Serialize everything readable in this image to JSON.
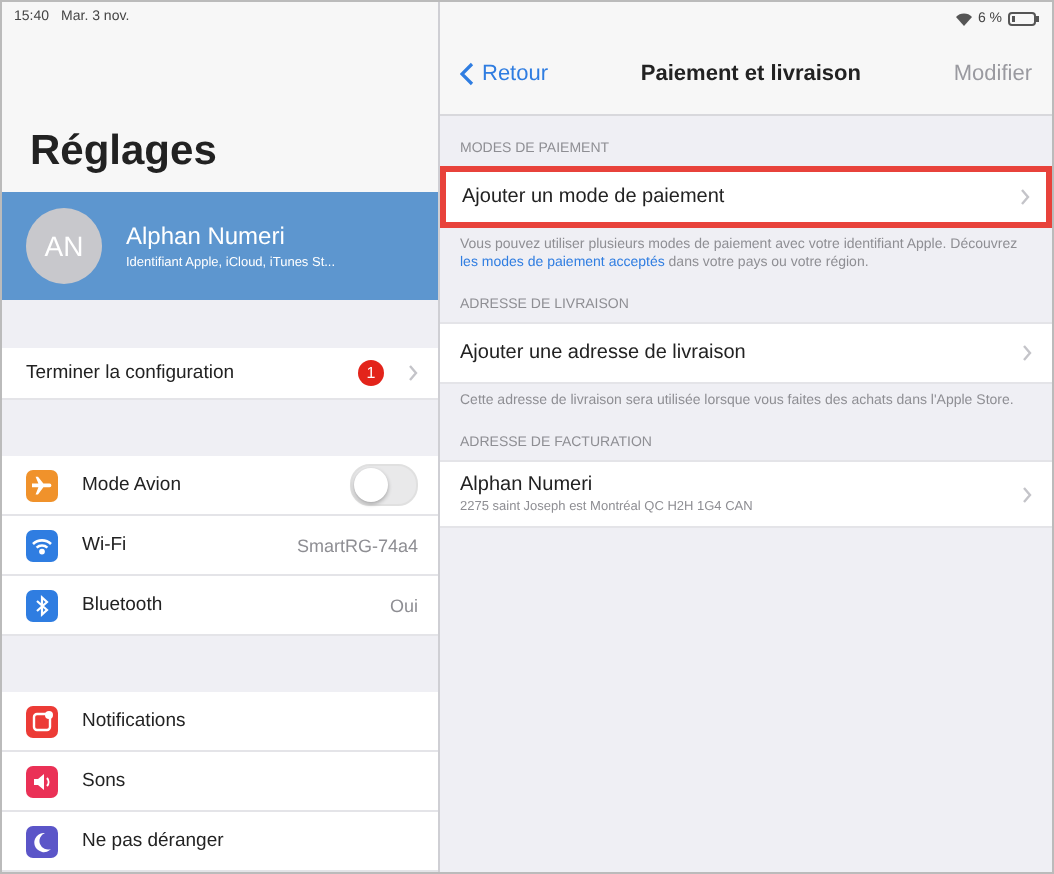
{
  "left": {
    "status_bar": {
      "time": "15:40",
      "date": "Mar. 3 nov."
    },
    "title": "Réglages",
    "profile": {
      "initials": "AN",
      "name": "Alphan Numeri",
      "subtitle": "Identifiant Apple, iCloud, iTunes St...",
      "selected": true
    },
    "setup_row": {
      "label": "Terminer la configuration",
      "badge": "1"
    },
    "groups": [
      [
        {
          "kind": "toggle",
          "label": "Mode Avion",
          "on": false
        },
        {
          "kind": "value",
          "label": "Wi-Fi",
          "value": "SmartRG-74a4"
        },
        {
          "kind": "value",
          "label": "Bluetooth",
          "value": "Oui"
        }
      ],
      [
        {
          "kind": "plain",
          "label": "Notifications"
        },
        {
          "kind": "plain",
          "label": "Sons"
        },
        {
          "kind": "plain",
          "label": "Ne pas déranger"
        }
      ]
    ]
  },
  "right": {
    "status_bar": {
      "battery": "6 %"
    },
    "nav": {
      "back": "Retour",
      "title": "Paiement et livraison",
      "edit": "Modifier",
      "edit_disabled": true
    },
    "sections": [
      {
        "header": "MODES DE PAIEMENT",
        "row": {
          "label": "Ajouter un mode de paiement",
          "highlighted": true
        },
        "footer": {
          "before": "Vous pouvez utiliser plusieurs modes de paiement avec votre identifiant Apple. Découvrez ",
          "link": "les modes de paiement acceptés",
          "after": " dans votre pays ou votre région."
        }
      },
      {
        "header": "ADRESSE DE LIVRAISON",
        "row": {
          "label": "Ajouter une adresse de livraison",
          "highlighted": false
        },
        "footer": {
          "before": "Cette adresse de livraison sera utilisée lorsque vous faites des achats dans l'Apple Store."
        }
      },
      {
        "header": "ADRESSE DE FACTURATION",
        "row": {
          "label": "Alphan Numeri",
          "detail": "2275 saint Joseph est Montréal QC H2H 1G4 CAN",
          "highlighted": false
        }
      }
    ]
  }
}
